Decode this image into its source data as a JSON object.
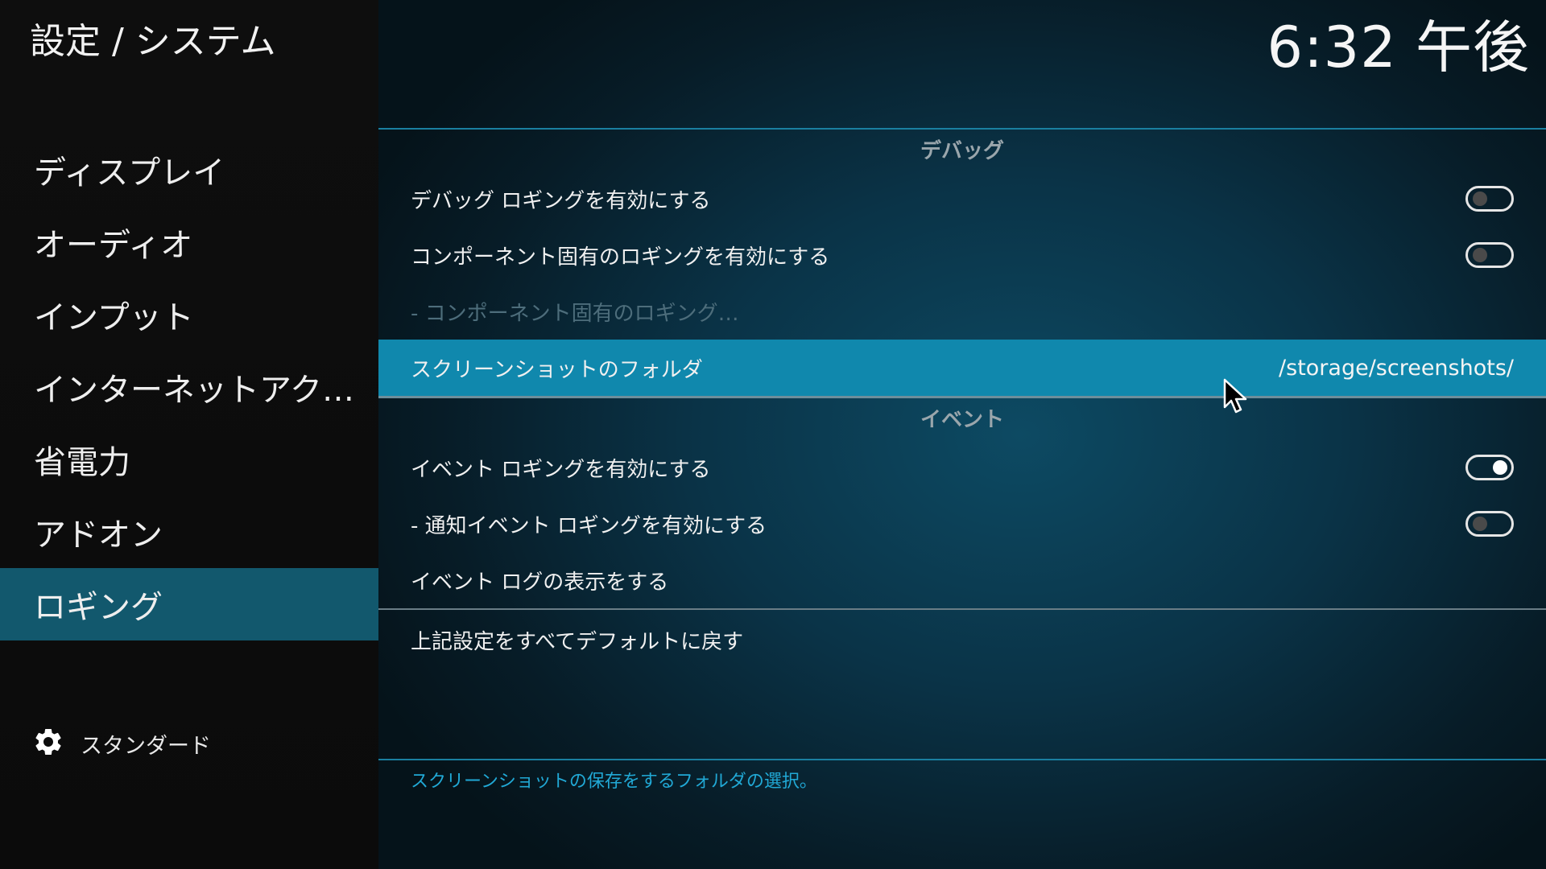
{
  "sidebar": {
    "title": "設定 / システム",
    "items": [
      {
        "label": "ディスプレイ",
        "active": false
      },
      {
        "label": "オーディオ",
        "active": false
      },
      {
        "label": "インプット",
        "active": false
      },
      {
        "label": "インターネットアク…",
        "active": false
      },
      {
        "label": "省電力",
        "active": false
      },
      {
        "label": "アドオン",
        "active": false
      },
      {
        "label": "ロギング",
        "active": true
      }
    ],
    "footer": {
      "icon": "gear-icon",
      "level_label": "スタンダード"
    }
  },
  "header": {
    "clock": "6:32 午後"
  },
  "settings": {
    "debug": {
      "header": "デバッグ",
      "debug_logging": {
        "label": "デバッグ ロギングを有効にする",
        "enabled": false
      },
      "component_logging": {
        "label": "コンポーネント固有のロギングを有効にする",
        "enabled": false
      },
      "component_logging_sub": {
        "label": "- コンポーネント固有のロギング…",
        "disabled": true
      },
      "screenshot_folder": {
        "label": "スクリーンショットのフォルダ",
        "value": "/storage/screenshots/",
        "selected": true
      }
    },
    "events": {
      "header": "イベント",
      "event_logging": {
        "label": "イベント ロギングを有効にする",
        "enabled": true
      },
      "notification_logging": {
        "label": "- 通知イベント ロギングを有効にする",
        "enabled": false
      },
      "show_event_log": {
        "label": "イベント ログの表示をする"
      }
    },
    "reset": {
      "label": "上記設定をすべてデフォルトに戻す"
    }
  },
  "help_text": "スクリーンショットの保存をするフォルダの選択。",
  "colors": {
    "accent_selected": "#1088ad",
    "sidebar_active": "#12586d",
    "help_text": "#21a9d6"
  }
}
